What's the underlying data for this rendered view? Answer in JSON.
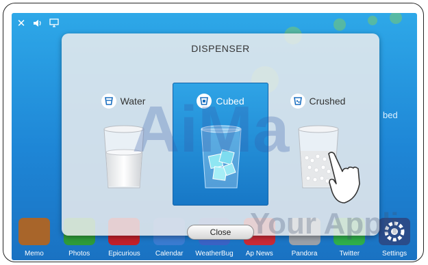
{
  "status_bar": {
    "icons": [
      "close-icon",
      "speaker-icon",
      "screen-icon"
    ]
  },
  "background": {
    "right_fragment": "bed"
  },
  "dialog": {
    "title": "DISPENSER",
    "options": [
      {
        "label": "Water",
        "icon": "water-icon",
        "selected": false
      },
      {
        "label": "Cubed",
        "icon": "cubed-ice-icon",
        "selected": true
      },
      {
        "label": "Crushed",
        "icon": "crushed-ice-icon",
        "selected": false
      }
    ],
    "close_label": "Close"
  },
  "dock": {
    "apps": [
      {
        "label": "Memo",
        "icon": "memo-icon",
        "color": "#a8652a"
      },
      {
        "label": "Photos",
        "icon": "photos-icon",
        "color": "#2e9b3a"
      },
      {
        "label": "Epicurious",
        "icon": "epicurious-icon",
        "color": "#c0202a"
      },
      {
        "label": "Calendar",
        "icon": "calendar-icon",
        "color": "#3a7bd0"
      },
      {
        "label": "WeatherBug",
        "icon": "weatherbug-icon",
        "color": "#3a62c4"
      },
      {
        "label": "Ap News",
        "icon": "ap-news-icon",
        "color": "#c82a36"
      },
      {
        "label": "Pandora",
        "icon": "pandora-icon",
        "color": "#9aa0a8"
      },
      {
        "label": "Twitter",
        "icon": "twitter-icon",
        "color": "#2fae4a"
      },
      {
        "label": "Settings",
        "icon": "settings-icon",
        "color": "#2a4c8a"
      }
    ]
  },
  "watermark": {
    "line1": "AiMa",
    "line2": "Your Appli"
  },
  "colors": {
    "screen_bg": "#1e86d6",
    "selected_option": "#1f8ad6",
    "dialog_bg": "#ebecee"
  }
}
